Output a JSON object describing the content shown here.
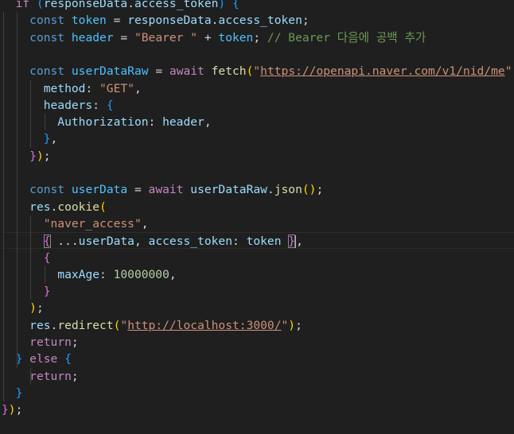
{
  "editor": {
    "lines": [
      [
        [
          "o",
          "  "
        ],
        [
          "k",
          "if"
        ],
        [
          "o",
          " "
        ],
        [
          "b3",
          "("
        ],
        [
          "p",
          "responseData"
        ],
        [
          "o",
          "."
        ],
        [
          "p",
          "access_token"
        ],
        [
          "b3",
          ")"
        ],
        [
          "o",
          " "
        ],
        [
          "b3",
          "{"
        ]
      ],
      [
        [
          "o",
          "    "
        ],
        [
          "st",
          "const"
        ],
        [
          "o",
          " "
        ],
        [
          "v",
          "token"
        ],
        [
          "o",
          " = "
        ],
        [
          "p",
          "responseData"
        ],
        [
          "o",
          "."
        ],
        [
          "p",
          "access_token"
        ],
        [
          "o",
          ";"
        ]
      ],
      [
        [
          "o",
          "    "
        ],
        [
          "st",
          "const"
        ],
        [
          "o",
          " "
        ],
        [
          "v",
          "header"
        ],
        [
          "o",
          " = "
        ],
        [
          "s",
          "\"Bearer \""
        ],
        [
          "o",
          " + "
        ],
        [
          "v",
          "token"
        ],
        [
          "o",
          "; "
        ],
        [
          "c",
          "// Bearer 다음에 공백 추가"
        ]
      ],
      [
        [
          "o",
          ""
        ]
      ],
      [
        [
          "o",
          "    "
        ],
        [
          "st",
          "const"
        ],
        [
          "o",
          " "
        ],
        [
          "v",
          "userDataRaw"
        ],
        [
          "o",
          " = "
        ],
        [
          "k",
          "await"
        ],
        [
          "o",
          " "
        ],
        [
          "f",
          "fetch"
        ],
        [
          "b1",
          "("
        ],
        [
          "s",
          "\""
        ],
        [
          "su",
          "https://openapi.naver.com/v1/nid/me"
        ],
        [
          "s",
          "\""
        ],
        [
          "o",
          ","
        ]
      ],
      [
        [
          "o",
          "      "
        ],
        [
          "p",
          "method"
        ],
        [
          "o",
          ": "
        ],
        [
          "s",
          "\"GET\""
        ],
        [
          "o",
          ","
        ]
      ],
      [
        [
          "o",
          "      "
        ],
        [
          "p",
          "headers"
        ],
        [
          "o",
          ": "
        ],
        [
          "b3",
          "{"
        ]
      ],
      [
        [
          "o",
          "        "
        ],
        [
          "p",
          "Authorization"
        ],
        [
          "o",
          ": "
        ],
        [
          "p",
          "header"
        ],
        [
          "o",
          ","
        ]
      ],
      [
        [
          "o",
          "      "
        ],
        [
          "b3",
          "}"
        ],
        [
          "o",
          ","
        ]
      ],
      [
        [
          "o",
          "    "
        ],
        [
          "b2",
          "}"
        ],
        [
          "b1",
          ")"
        ],
        [
          "o",
          ";"
        ]
      ],
      [
        [
          "o",
          ""
        ]
      ],
      [
        [
          "o",
          "    "
        ],
        [
          "st",
          "const"
        ],
        [
          "o",
          " "
        ],
        [
          "v",
          "userData"
        ],
        [
          "o",
          " = "
        ],
        [
          "k",
          "await"
        ],
        [
          "o",
          " "
        ],
        [
          "p",
          "userDataRaw"
        ],
        [
          "o",
          "."
        ],
        [
          "f",
          "json"
        ],
        [
          "b1",
          "()"
        ],
        [
          "o",
          ";"
        ]
      ],
      [
        [
          "o",
          "    "
        ],
        [
          "p",
          "res"
        ],
        [
          "o",
          "."
        ],
        [
          "f",
          "cookie"
        ],
        [
          "b1",
          "("
        ]
      ],
      [
        [
          "o",
          "      "
        ],
        [
          "s",
          "\"naver_access\""
        ],
        [
          "o",
          ","
        ]
      ],
      [
        [
          "o",
          "      "
        ],
        [
          "b2m",
          "{"
        ],
        [
          "o",
          " ..."
        ],
        [
          "p",
          "userData"
        ],
        [
          "o",
          ", "
        ],
        [
          "p",
          "access_token"
        ],
        [
          "o",
          ": "
        ],
        [
          "p",
          "token"
        ],
        [
          "o",
          " "
        ],
        [
          "b2m",
          "}"
        ],
        [
          "cur",
          ""
        ],
        [
          "o",
          ","
        ]
      ],
      [
        [
          "o",
          "      "
        ],
        [
          "b2",
          "{"
        ]
      ],
      [
        [
          "o",
          "        "
        ],
        [
          "p",
          "maxAge"
        ],
        [
          "o",
          ": "
        ],
        [
          "n",
          "10000000"
        ],
        [
          "o",
          ","
        ]
      ],
      [
        [
          "o",
          "      "
        ],
        [
          "b2",
          "}"
        ]
      ],
      [
        [
          "o",
          "    "
        ],
        [
          "b1",
          ")"
        ],
        [
          "o",
          ";"
        ]
      ],
      [
        [
          "o",
          "    "
        ],
        [
          "p",
          "res"
        ],
        [
          "o",
          "."
        ],
        [
          "f",
          "redirect"
        ],
        [
          "b1",
          "("
        ],
        [
          "s",
          "\""
        ],
        [
          "su",
          "http://localhost:3000/"
        ],
        [
          "s",
          "\""
        ],
        [
          "b1",
          ")"
        ],
        [
          "o",
          ";"
        ]
      ],
      [
        [
          "o",
          "    "
        ],
        [
          "k",
          "return"
        ],
        [
          "o",
          ";"
        ]
      ],
      [
        [
          "o",
          "  "
        ],
        [
          "b3",
          "}"
        ],
        [
          "o",
          " "
        ],
        [
          "k",
          "else"
        ],
        [
          "o",
          " "
        ],
        [
          "b3",
          "{"
        ]
      ],
      [
        [
          "o",
          "    "
        ],
        [
          "k",
          "return"
        ],
        [
          "o",
          ";"
        ]
      ],
      [
        [
          "o",
          "  "
        ],
        [
          "b3",
          "}"
        ]
      ],
      [
        [
          "b2",
          "}"
        ],
        [
          "b1",
          ")"
        ],
        [
          "o",
          ";"
        ]
      ]
    ]
  }
}
